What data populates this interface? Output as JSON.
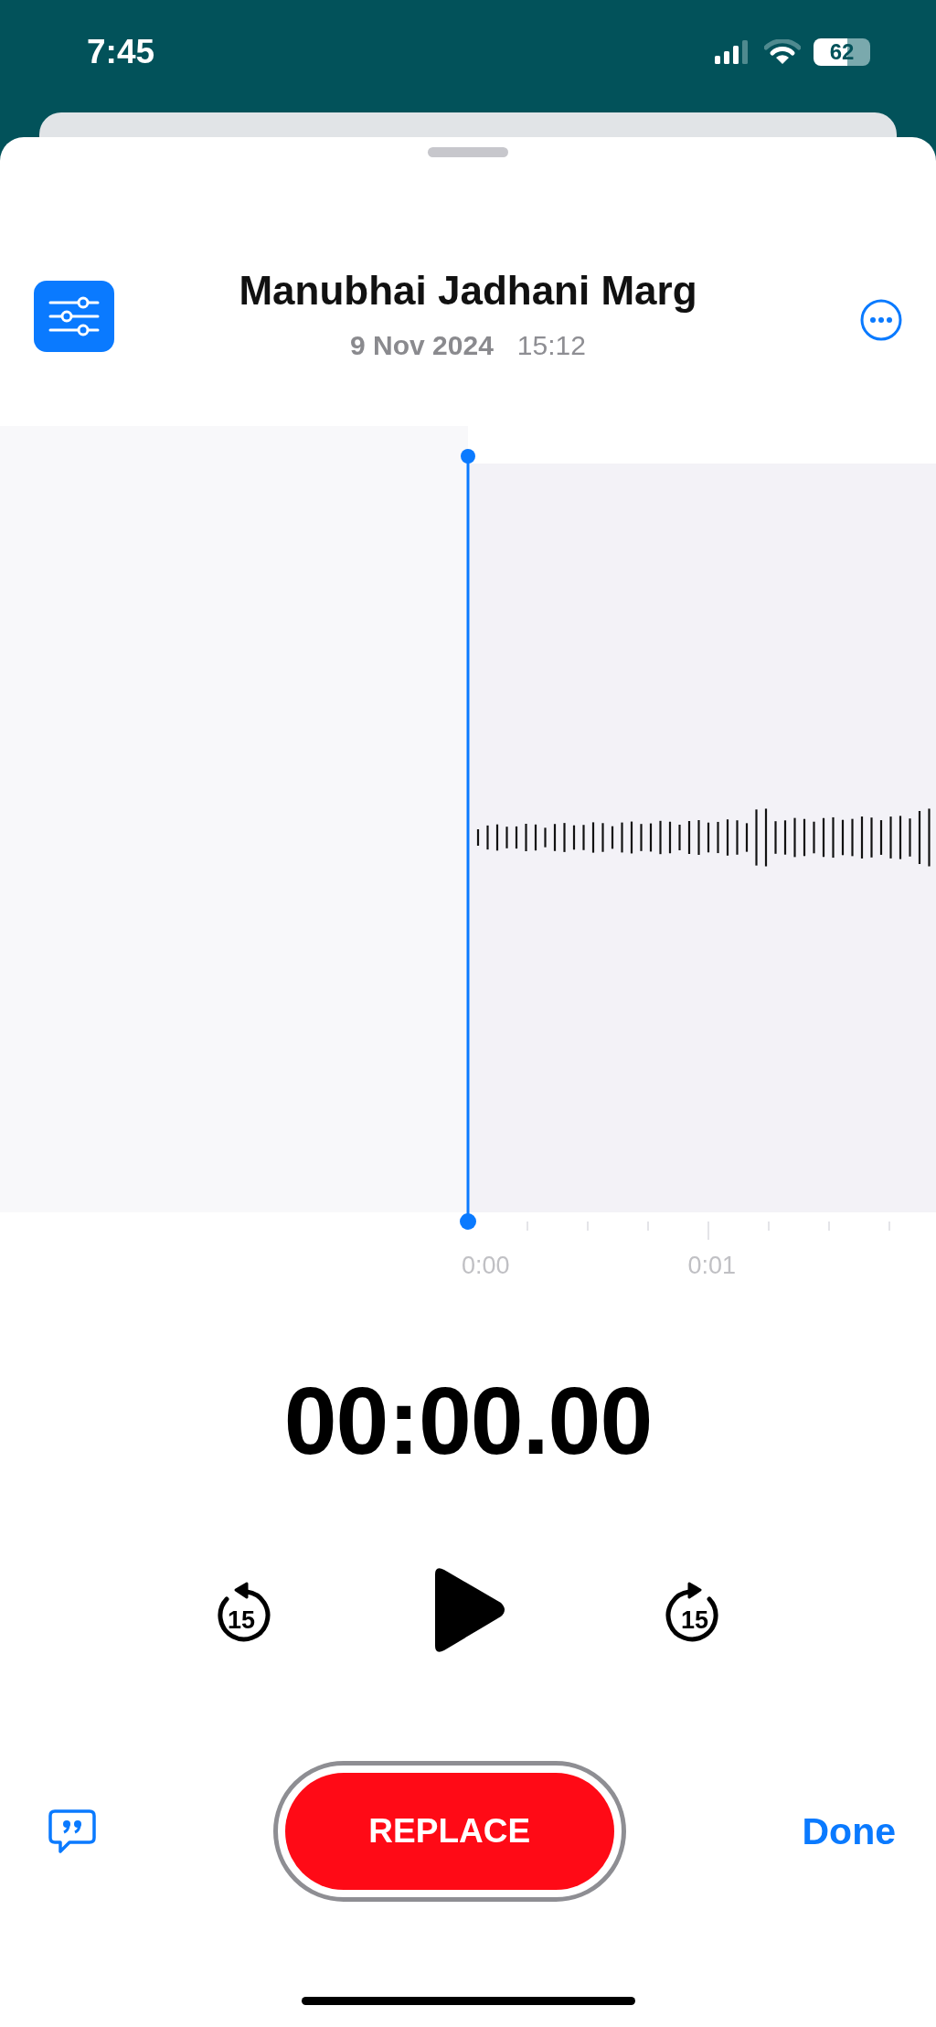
{
  "status_bar": {
    "time": "7:45",
    "battery": "62"
  },
  "recording": {
    "title": "Manubhai Jadhani Marg",
    "date": "9 Nov 2024",
    "time": "15:12"
  },
  "timeline": {
    "labels": [
      "0:00",
      "0:01"
    ]
  },
  "timer": "00:00.00",
  "transport": {
    "skip_back": "15",
    "skip_forward": "15"
  },
  "actions": {
    "replace": "REPLACE",
    "done": "Done"
  }
}
